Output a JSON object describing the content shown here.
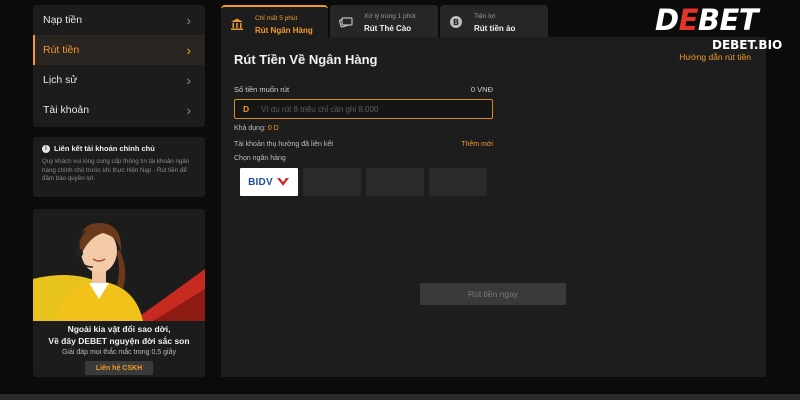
{
  "sidebar": {
    "items": [
      {
        "label": "Nạp tiền"
      },
      {
        "label": "Rút tiền"
      },
      {
        "label": "Lịch sử"
      },
      {
        "label": "Tài khoản"
      }
    ],
    "notice": {
      "title": "Liên kết tài khoản chính chủ",
      "text": "Quý khách vui lòng cung cấp thông tin tài khoản ngân hàng chính chủ trước khi thực hiện Nạp - Rút tiền để đảm bảo quyền lợi."
    },
    "promo": {
      "line1": "Ngoài kia vật đổi sao dời,",
      "line2": "Về đây DEBET nguyện đời sắc son",
      "sub": "Giải đáp mọi thắc mắc trong 0,5 giây",
      "button": "Liên hệ CSKH"
    }
  },
  "tabs": [
    {
      "small": "Chỉ mất 5 phút",
      "big": "Rút Ngân Hàng",
      "icon": "bank-icon"
    },
    {
      "small": "Xử lý trong 1 phút",
      "big": "Rút Thẻ Cào",
      "icon": "card-icon"
    },
    {
      "small": "Tiện lợi",
      "big": "Rút tiền ảo",
      "icon": "bitcoin-icon"
    }
  ],
  "panel": {
    "title": "Rút Tiền Về Ngân Hàng",
    "guide_link": "Hướng dẫn rút tiền",
    "amount_label": "Số tiền muốn rút",
    "amount_value": "0 VNĐ",
    "currency_symbol": "D",
    "amount_placeholder": "Ví dụ rút 8 triệu chỉ cần ghi 8.000",
    "balance_label": "Khả dụng:",
    "balance_value": "0 D",
    "linked_label": "Tài khoản thụ hưởng đã liên kết",
    "add_new": "Thêm mới",
    "bank_label": "Chọn ngân hàng",
    "banks": [
      {
        "name": "BIDV",
        "selected": true
      },
      {
        "name": "",
        "selected": false
      },
      {
        "name": "",
        "selected": false
      },
      {
        "name": "",
        "selected": false
      }
    ],
    "submit_label": "Rút tiền ngay"
  },
  "logo": {
    "main_prefix": "D",
    "main_red": "E",
    "main_suffix": "BET",
    "sub": "DEBET.BIO"
  },
  "colors": {
    "accent": "#f39a2c",
    "background": "#0b0b0b",
    "panel": "#1d1d1d",
    "brand_red": "#e3352b"
  }
}
